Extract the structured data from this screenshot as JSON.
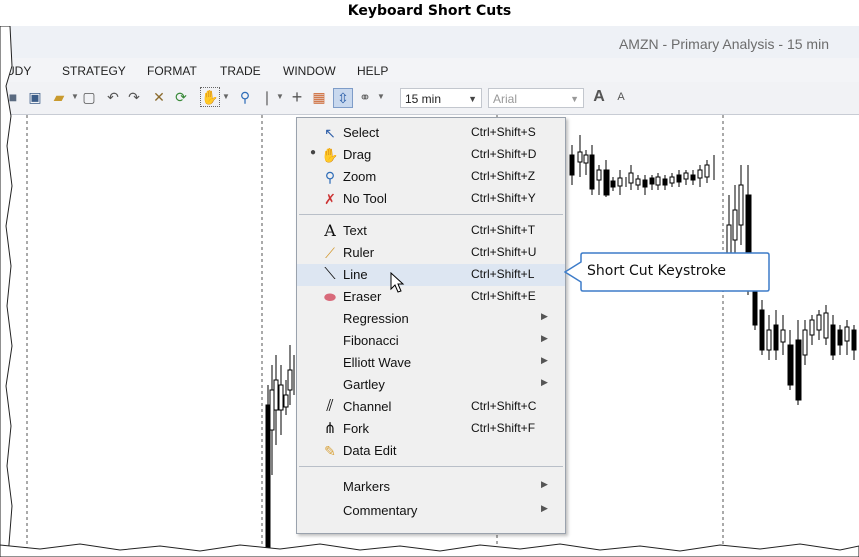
{
  "heading": "Keyboard Short Cuts",
  "window": {
    "title": "AMZN - Primary Analysis - 15 min"
  },
  "menubar": [
    "UDY",
    "STRATEGY",
    "FORMAT",
    "TRADE",
    "WINDOW",
    "HELP"
  ],
  "toolbar": {
    "interval": "15 min",
    "font": "Arial",
    "icons": [
      "save-icon",
      "save-as-icon",
      "open-folder-icon",
      "screenshot-icon",
      "undo-icon",
      "redo-icon",
      "wand-icon",
      "refresh-icon",
      "drag-tool-icon",
      "zoom-icon",
      "pen-icon",
      "crosshair-icon",
      "chart-style-icon",
      "fit-icon",
      "link-icon",
      "font-grow-icon",
      "font-shrink-icon"
    ]
  },
  "tool_menu": {
    "items": [
      {
        "label": "Select",
        "shortcut": "Ctrl+Shift+S",
        "icon": "pointer-icon"
      },
      {
        "label": "Drag",
        "shortcut": "Ctrl+Shift+D",
        "icon": "drag-icon",
        "selected": true
      },
      {
        "label": "Zoom",
        "shortcut": "Ctrl+Shift+Z",
        "icon": "zoom-icon"
      },
      {
        "label": "No Tool",
        "shortcut": "Ctrl+Shift+Y",
        "icon": "no-tool-icon"
      },
      {
        "label": "Text",
        "shortcut": "Ctrl+Shift+T",
        "icon": "text-icon"
      },
      {
        "label": "Ruler",
        "shortcut": "Ctrl+Shift+U",
        "icon": "ruler-icon"
      },
      {
        "label": "Line",
        "shortcut": "Ctrl+Shift+L",
        "icon": "line-icon",
        "hovered": true
      },
      {
        "label": "Eraser",
        "shortcut": "Ctrl+Shift+E",
        "icon": "eraser-icon"
      },
      {
        "label": "Regression",
        "submenu": true
      },
      {
        "label": "Fibonacci",
        "submenu": true
      },
      {
        "label": "Elliott Wave",
        "submenu": true
      },
      {
        "label": "Gartley",
        "submenu": true
      },
      {
        "label": "Channel",
        "shortcut": "Ctrl+Shift+C",
        "icon": "channel-icon"
      },
      {
        "label": "Fork",
        "shortcut": "Ctrl+Shift+F",
        "icon": "fork-icon"
      },
      {
        "label": "Data Edit",
        "icon": "data-edit-icon"
      },
      {
        "label": "Markers",
        "submenu": true
      },
      {
        "label": "Commentary",
        "submenu": true
      }
    ]
  },
  "callout": "Short Cut Keystroke",
  "colors": {
    "menu_bg": "#f0f0f0",
    "hover_bg": "#dde6f2",
    "border": "#9aa2ad",
    "accent": "#3d7cc9"
  }
}
